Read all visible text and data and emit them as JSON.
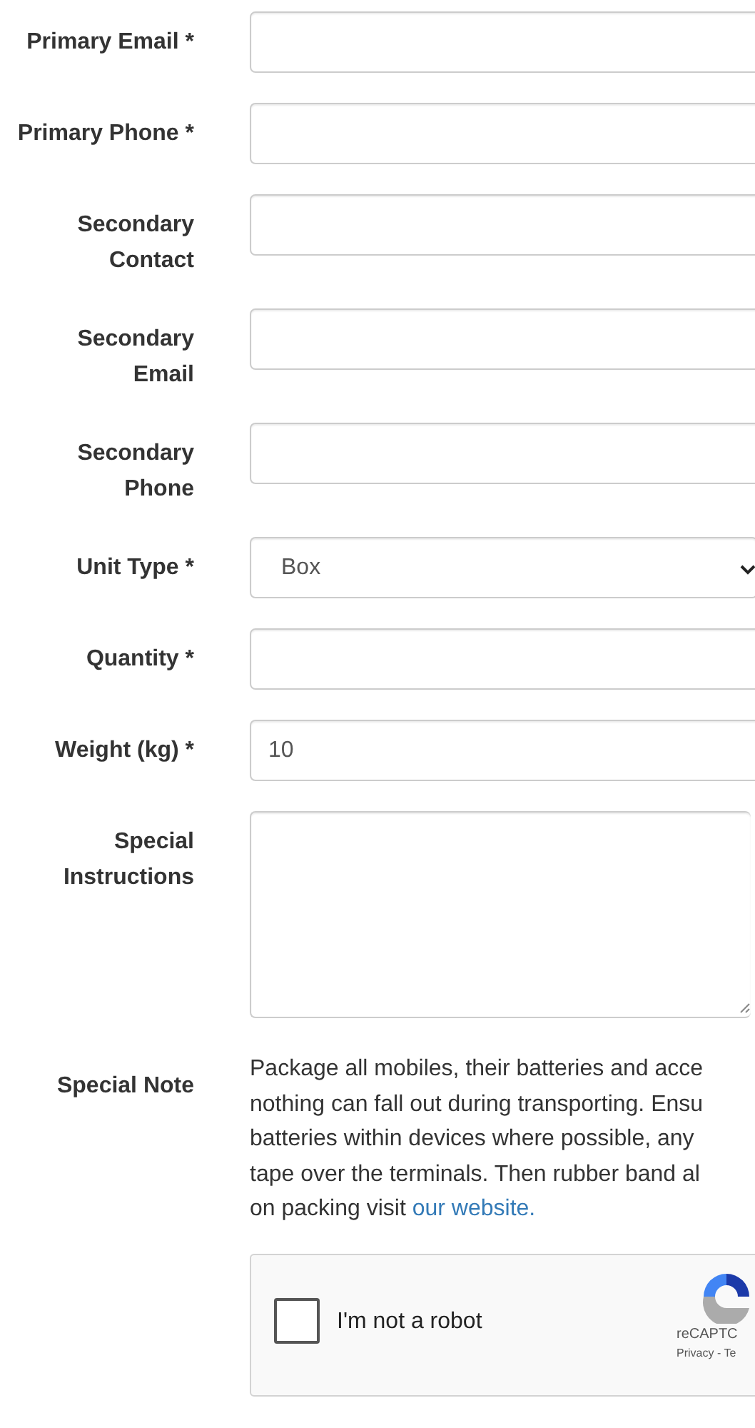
{
  "fields": [
    {
      "label": "Primary Email *",
      "kind": "input"
    },
    {
      "label": "Primary Phone *",
      "kind": "input"
    },
    {
      "label": "Secondary Contact",
      "kind": "input"
    },
    {
      "label": "Secondary Email",
      "kind": "input"
    },
    {
      "label": "Secondary Phone",
      "kind": "input"
    },
    {
      "label": "Unit Type *",
      "kind": "select",
      "value": "Box"
    },
    {
      "label": "Quantity *",
      "kind": "input"
    },
    {
      "label": "Weight (kg) *",
      "kind": "input",
      "value": "10"
    },
    {
      "label": "Special Instructions",
      "kind": "textarea"
    }
  ],
  "special_note": {
    "label": "Special Note",
    "lines": [
      "Package all mobiles, their batteries and acce",
      "nothing can fall out during transporting. Ensu",
      "batteries within devices where possible, any",
      "tape over the terminals. Then rubber band al",
      "on packing visit "
    ],
    "link": "our website."
  },
  "captcha": {
    "checked": false,
    "label": "I'm not a robot",
    "brand": "reCAPTC",
    "links": "Privacy - Te"
  }
}
